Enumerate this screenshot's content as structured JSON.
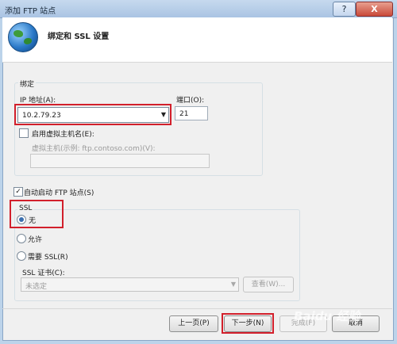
{
  "window": {
    "title": "添加 FTP 站点",
    "help_label": "?",
    "close_label": "X"
  },
  "header": {
    "title": "绑定和 SSL 设置",
    "icon": "globe-icon"
  },
  "binding": {
    "group_label": "绑定",
    "ip_label": "IP 地址(A):",
    "ip_value": "10.2.79.23",
    "port_label": "端口(O):",
    "port_value": "21",
    "virtual_host_checkbox_label": "启用虚拟主机名(E):",
    "virtual_host_checked": false,
    "virtual_host_label": "虚拟主机(示例: ftp.contoso.com)(V):",
    "virtual_host_value": ""
  },
  "autostart": {
    "label": "自动启动 FTP 站点(S)",
    "checked": true,
    "check_mark": "✓"
  },
  "ssl": {
    "group_label": "SSL",
    "options": [
      {
        "label": "无",
        "selected": true
      },
      {
        "label": "允许",
        "selected": false
      },
      {
        "label": "需要 SSL(R)",
        "selected": false
      }
    ],
    "cert_label": "SSL 证书(C):",
    "cert_value": "未选定",
    "view_button": "查看(W)..."
  },
  "footer": {
    "prev_button": "上一页(P)",
    "next_button": "下一步(N)",
    "finish_button": "完成(F)",
    "cancel_button": "取消"
  },
  "watermark": "Baidu 经验",
  "colors": {
    "highlight": "#d21f2b",
    "title_bar": "#c6d9ee",
    "dialog_bg": "#f0f0f0"
  }
}
